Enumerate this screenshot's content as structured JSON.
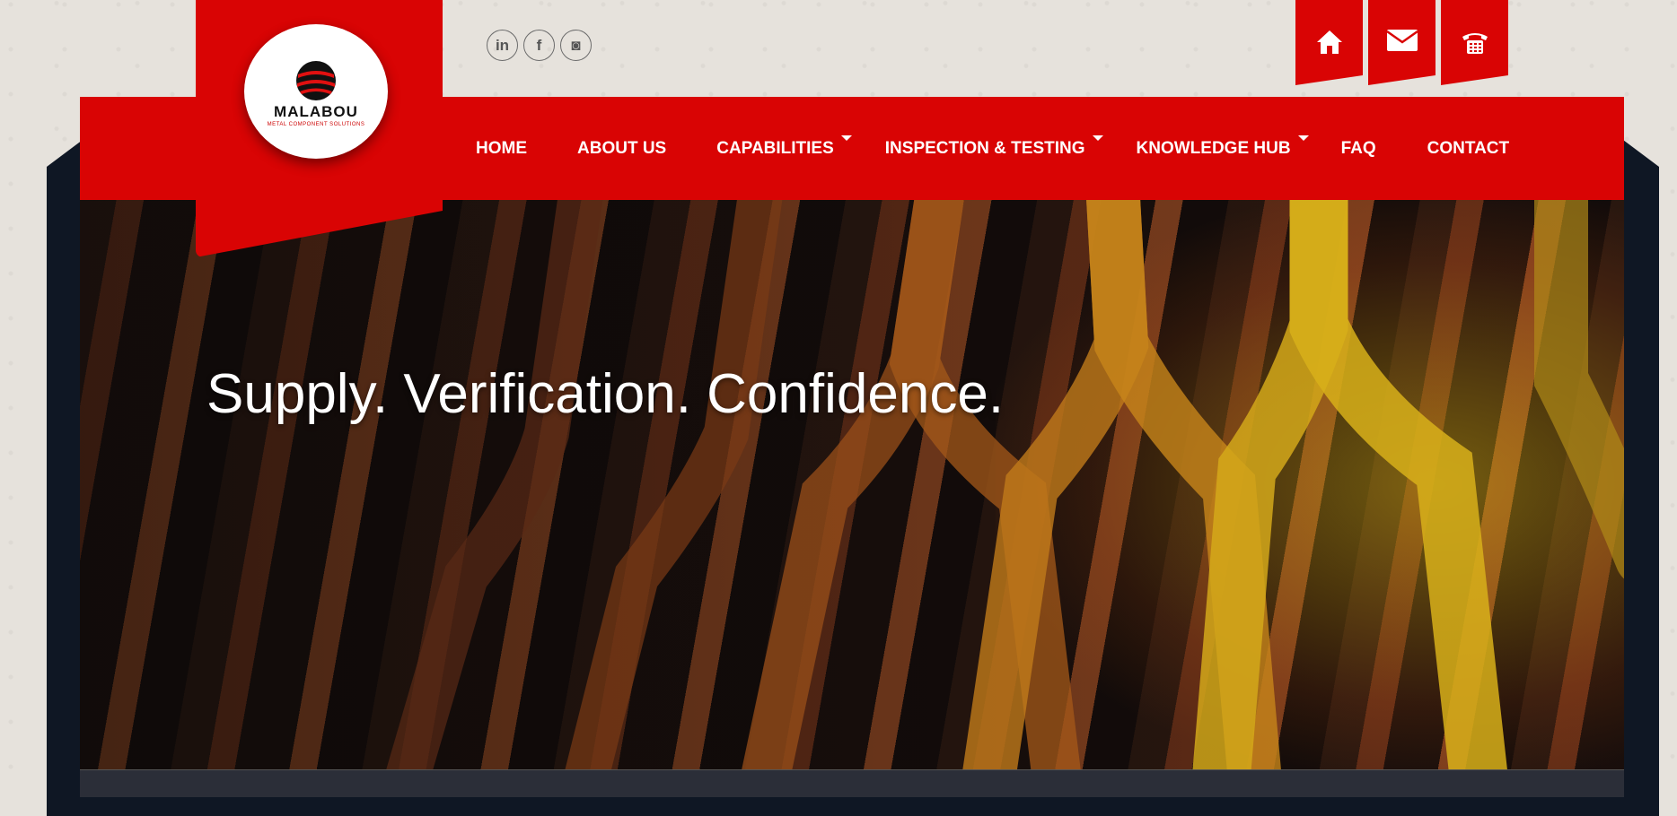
{
  "social": [
    {
      "name": "linkedin",
      "glyph": "in"
    },
    {
      "name": "facebook",
      "glyph": "f"
    },
    {
      "name": "instagram",
      "glyph": "◙"
    }
  ],
  "top_tabs": [
    {
      "name": "home",
      "icon": "home-icon"
    },
    {
      "name": "mail",
      "icon": "envelope-icon"
    },
    {
      "name": "phone",
      "icon": "phone-icon"
    }
  ],
  "logo": {
    "word": "MALABOU",
    "tagline": "METAL COMPONENT SOLUTIONS"
  },
  "nav": {
    "items": [
      {
        "label": "HOME",
        "dropdown": false
      },
      {
        "label": "ABOUT US",
        "dropdown": false
      },
      {
        "label": "CAPABILITIES",
        "dropdown": true
      },
      {
        "label": "INSPECTION & TESTING",
        "dropdown": true
      },
      {
        "label": "KNOWLEDGE HUB",
        "dropdown": true
      },
      {
        "label": "FAQ",
        "dropdown": false
      },
      {
        "label": "CONTACT",
        "dropdown": false
      }
    ]
  },
  "hero": {
    "headline": "Supply. Verification. Confidence."
  },
  "colors": {
    "brand_red": "#d90404",
    "frame_dark": "#0f1724",
    "page_bg": "#e6e2dc"
  }
}
